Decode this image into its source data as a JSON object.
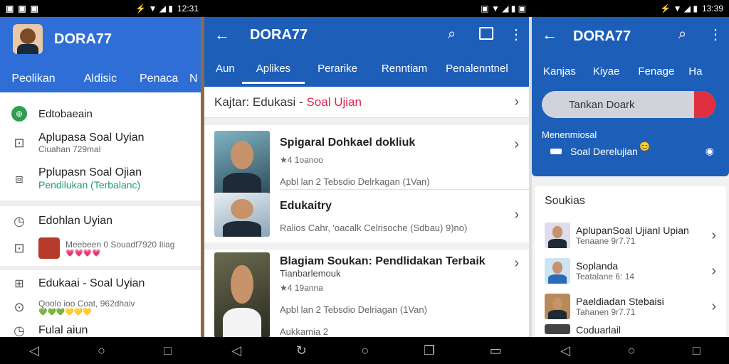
{
  "status_left": {
    "time": "12:31"
  },
  "status_mid": {
    "time": ""
  },
  "status_right": {
    "time": "13:39"
  },
  "panel1": {
    "title": "DORA77",
    "tabs": [
      "Peolikan",
      "Aldisic",
      "Penaca",
      "N"
    ],
    "items": [
      {
        "title": "Edtobaeain",
        "sub": ""
      },
      {
        "title": "Aplupasa Soal Uyian",
        "sub": "Ciuahan 729mal"
      },
      {
        "title": "Pplupasn Soal Ojian",
        "sub": "Pendilukan (Terbalanc)"
      },
      {
        "title": "Edohlan Uyian",
        "sub": ""
      },
      {
        "title": "",
        "sub": "Meebeen 0 Souadf7920 Iliag"
      },
      {
        "title": "Edukaai - Soal Uyian",
        "sub": "Qoolo ioo Coat, 962dhaiv"
      },
      {
        "title": "Fulal aiun",
        "sub": ""
      }
    ],
    "emoji_row1": "💗💗💗💗",
    "emoji_row2": "💚💚💚💛💛💛"
  },
  "panel2": {
    "title": "DORA77",
    "tabs": [
      "Aun",
      "Aplikes",
      "Perarike",
      "Renntiam",
      "Penalenntnel"
    ],
    "breadcrumb_prefix": "Kajtar: Edukasi - ",
    "breadcrumb_highlight": "Soal Ujian",
    "cards": [
      {
        "title": "Spigaral Dohkael dokliuk",
        "meta": "★4 1oanoo",
        "desc": "Apbl lan 2 Tebsdio Delrkagan (1Van)"
      },
      {
        "title": "Edukaitry",
        "meta": "",
        "desc": "Ralios Cahr, 'oacalk  Celrisoche (Sdbau)  9)no)"
      },
      {
        "title": "Blagiam Soukan: Pendlidakan Terbaik",
        "meta": "Tianbarlemouk",
        "meta2": "★4 19anna",
        "desc": "Apbl lan 2 Tebsdio Delriagan (1Van)",
        "extra": "Aukkamia 2"
      }
    ]
  },
  "panel3": {
    "title": "DORA77",
    "tabs": [
      "Kanjas",
      "Kiyae",
      "Fenage",
      "Ha"
    ],
    "search_pill": "Tankan Doark",
    "section_label": "Menenmiosal",
    "row_label": "Soal Derelujian",
    "list_title": "Soukias",
    "list": [
      {
        "title": "AplupanSoal Ujianl Upian",
        "sub": "Tenaane 9r7.71"
      },
      {
        "title": "Soplanda",
        "sub": "Teatalane 6: 14"
      },
      {
        "title": "Paeldiadan Stebaisi",
        "sub": "Tahanen 9r7.71"
      },
      {
        "title": "Coduarlail",
        "sub": ""
      }
    ]
  },
  "colors": {
    "blue1": "#2f6ed6",
    "blue2": "#1d5fb8",
    "accent_red": "#e02050",
    "teal": "#1a9a7a"
  }
}
